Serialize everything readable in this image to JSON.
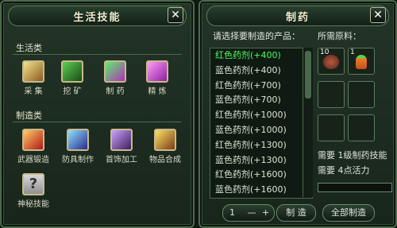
{
  "left_panel": {
    "title": "生活技能",
    "sections": {
      "life": "生活类",
      "craft": "制造类"
    },
    "life_skills": [
      {
        "label": "采 集",
        "icon": "gather-icon"
      },
      {
        "label": "挖 矿",
        "icon": "mining-icon"
      },
      {
        "label": "制 药",
        "icon": "alchemy-icon"
      },
      {
        "label": "精 炼",
        "icon": "refining-icon"
      }
    ],
    "craft_skills": [
      {
        "label": "武器锻造",
        "icon": "weapon-forging-icon"
      },
      {
        "label": "防具制作",
        "icon": "armor-crafting-icon"
      },
      {
        "label": "首饰加工",
        "icon": "jewelry-icon"
      },
      {
        "label": "物品合成",
        "icon": "synthesis-icon"
      },
      {
        "label": "神秘技能",
        "icon": "mystery-icon"
      }
    ],
    "close_glyph": "✕"
  },
  "right_panel": {
    "title": "制药",
    "list_prompt": "请选择要制造的产品：",
    "materials_label": "所需原料：",
    "products": [
      {
        "name": "红色药剂(+400)",
        "selected": true
      },
      {
        "name": "蓝色药剂(+400)",
        "selected": false
      },
      {
        "name": "红色药剂(+700)",
        "selected": false
      },
      {
        "name": "蓝色药剂(+700)",
        "selected": false
      },
      {
        "name": "红色药剂(+1000)",
        "selected": false
      },
      {
        "name": "蓝色药剂(+1000)",
        "selected": false
      },
      {
        "name": "红色药剂(+1300)",
        "selected": false
      },
      {
        "name": "蓝色药剂(+1300)",
        "selected": false
      },
      {
        "name": "红色药剂(+1600)",
        "selected": false
      },
      {
        "name": "蓝色药剂(+1600)",
        "selected": false
      }
    ],
    "materials": [
      {
        "qty": "10",
        "icon": "herb-bundle-icon"
      },
      {
        "qty": "1",
        "icon": "carrot-icon"
      }
    ],
    "requirements": [
      "需要 1级制药技能",
      "需要 4点活力"
    ],
    "quantity": "1",
    "minus": "—",
    "plus": "+",
    "make_label": "制 造",
    "make_all_label": "全部制造",
    "close_glyph": "✕",
    "colors": {
      "selected": "#48ff58"
    }
  }
}
